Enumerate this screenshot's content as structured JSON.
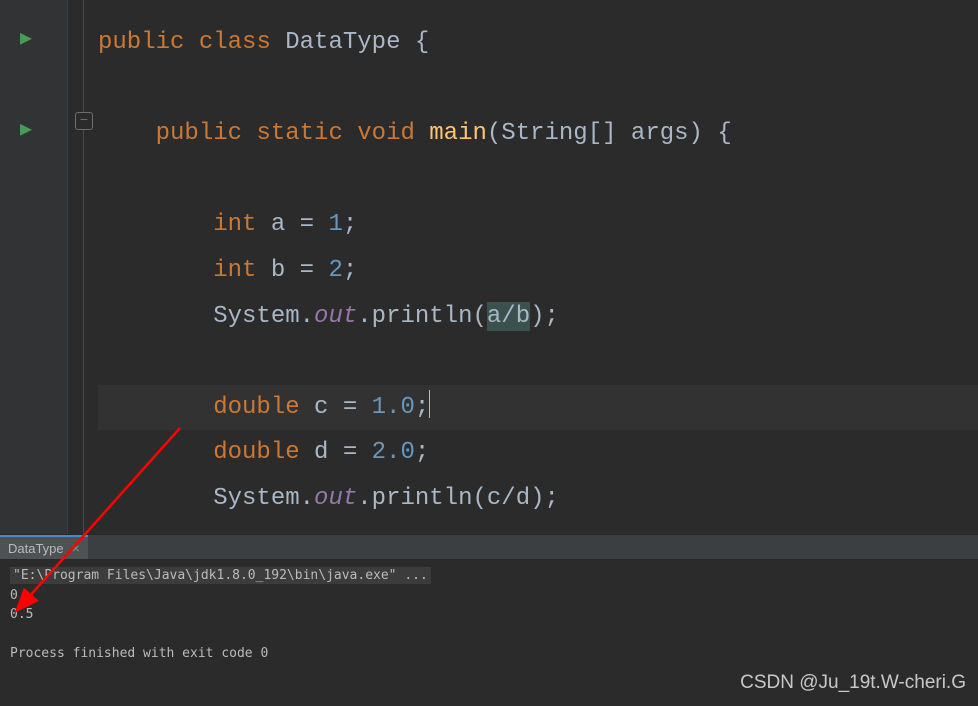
{
  "code": {
    "line1_kw1": "public",
    "line1_kw2": "class",
    "line1_cls": "DataType",
    "line1_brace": "{",
    "line3_kw1": "public",
    "line3_kw2": "static",
    "line3_kw3": "void",
    "line3_fn": "main",
    "line3_params": "(String[] args) {",
    "line5_kw": "int",
    "line5_rest": " a = ",
    "line5_num": "1",
    "line5_semi": ";",
    "line6_kw": "int",
    "line6_rest": " b = ",
    "line6_num": "2",
    "line6_semi": ";",
    "line7_sys": "System.",
    "line7_out": "out",
    "line7_println": ".println(",
    "line7_expr": "a/b",
    "line7_end": ");",
    "line9_kw": "double",
    "line9_rest": " c = ",
    "line9_num": "1.0",
    "line9_semi": ";",
    "line10_kw": "double",
    "line10_rest": " d = ",
    "line10_num": "2.0",
    "line10_semi": ";",
    "line11_sys": "System.",
    "line11_out": "out",
    "line11_println": ".println(c/d);"
  },
  "tab": {
    "name": "DataType",
    "close": "×"
  },
  "console": {
    "cmd": "\"E:\\Program Files\\Java\\jdk1.8.0_192\\bin\\java.exe\" ...",
    "out1": "0",
    "out2": "0.5",
    "exit": "Process finished with exit code 0"
  },
  "watermark": "CSDN @Ju_19t.W-cheri.G"
}
